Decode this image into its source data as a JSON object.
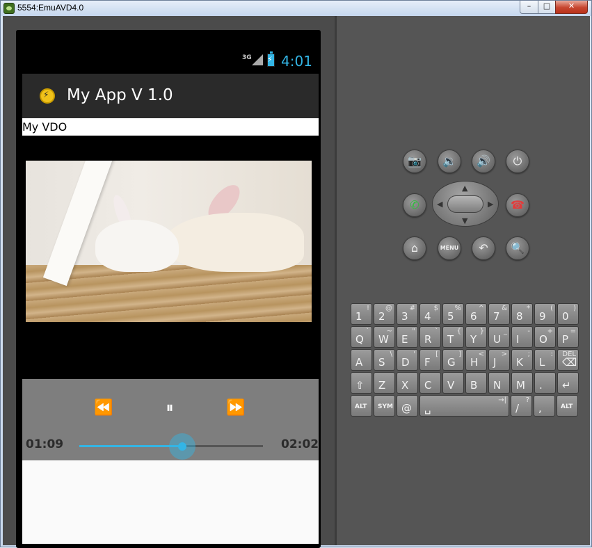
{
  "window": {
    "title": "5554:EmuAVD4.0",
    "min_label": "–",
    "max_label": "□",
    "close_label": "✕"
  },
  "status_bar": {
    "network": "3G",
    "time": "4:01"
  },
  "action_bar": {
    "title": "My App V 1.0"
  },
  "content": {
    "label": "My VDO"
  },
  "media_controller": {
    "rewind_icon": "⏪",
    "pause_icon": "⏸",
    "ffwd_icon": "⏩",
    "current_time": "01:09",
    "total_time": "02:02",
    "progress": 0.56,
    "accent_color": "#33b5e5"
  },
  "hardware_buttons": {
    "camera": "📷",
    "vol_down": "🔉",
    "vol_up": "🔊",
    "power": "⏻",
    "call": "✆",
    "end_call": "☎",
    "home": "⌂",
    "menu": "MENU",
    "back": "↶",
    "search": "🔍",
    "dpad_up": "▲",
    "dpad_down": "▼",
    "dpad_left": "◀",
    "dpad_right": "▶"
  },
  "keyboard": {
    "rows": [
      [
        {
          "main": "1",
          "alt": "!"
        },
        {
          "main": "2",
          "alt": "@"
        },
        {
          "main": "3",
          "alt": "#"
        },
        {
          "main": "4",
          "alt": "$"
        },
        {
          "main": "5",
          "alt": "%"
        },
        {
          "main": "6",
          "alt": "^"
        },
        {
          "main": "7",
          "alt": "&"
        },
        {
          "main": "8",
          "alt": "*"
        },
        {
          "main": "9",
          "alt": "("
        },
        {
          "main": "0",
          "alt": ")"
        }
      ],
      [
        {
          "main": "Q",
          "alt": "`"
        },
        {
          "main": "W",
          "alt": "~"
        },
        {
          "main": "E",
          "alt": "\""
        },
        {
          "main": "R",
          "alt": "`"
        },
        {
          "main": "T",
          "alt": "{"
        },
        {
          "main": "Y",
          "alt": "}"
        },
        {
          "main": "U",
          "alt": "_"
        },
        {
          "main": "I",
          "alt": "-"
        },
        {
          "main": "O",
          "alt": "+"
        },
        {
          "main": "P",
          "alt": "="
        }
      ],
      [
        {
          "main": "A",
          "alt": ""
        },
        {
          "main": "S",
          "alt": "\\"
        },
        {
          "main": "D",
          "alt": "'"
        },
        {
          "main": "F",
          "alt": "["
        },
        {
          "main": "G",
          "alt": "]"
        },
        {
          "main": "H",
          "alt": "<"
        },
        {
          "main": "J",
          "alt": ">"
        },
        {
          "main": "K",
          "alt": ";"
        },
        {
          "main": "L",
          "alt": ":"
        },
        {
          "main": "⌫",
          "alt": "DEL"
        }
      ],
      [
        {
          "main": "⇧",
          "alt": ""
        },
        {
          "main": "Z",
          "alt": ""
        },
        {
          "main": "X",
          "alt": ""
        },
        {
          "main": "C",
          "alt": ""
        },
        {
          "main": "V",
          "alt": ""
        },
        {
          "main": "B",
          "alt": ""
        },
        {
          "main": "N",
          "alt": ""
        },
        {
          "main": "M",
          "alt": ""
        },
        {
          "main": ".",
          "alt": ""
        },
        {
          "main": "↵",
          "alt": ""
        }
      ],
      [
        {
          "main": "ALT",
          "alt": ""
        },
        {
          "main": "SYM",
          "alt": ""
        },
        {
          "main": "@",
          "alt": ""
        },
        {
          "main": "␣",
          "alt": "→|"
        },
        {
          "main": "/",
          "alt": "?"
        },
        {
          "main": ",",
          "alt": ""
        },
        {
          "main": "ALT",
          "alt": ""
        }
      ]
    ]
  }
}
